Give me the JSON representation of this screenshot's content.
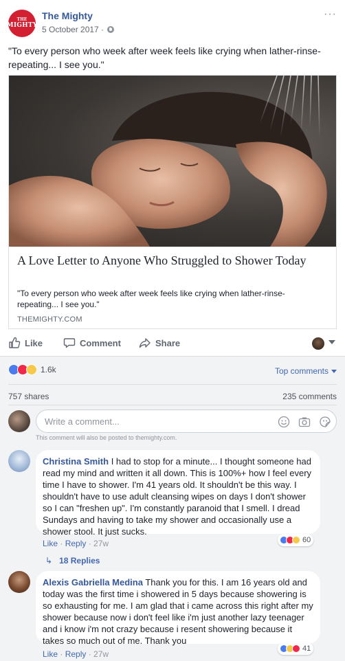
{
  "post": {
    "page_name": "The Mighty",
    "logo_small": "THE",
    "logo_big": "MIGHTY",
    "date": "5 October 2017 ·",
    "more": "···",
    "text": "\"To every person who week after week feels like crying when lather-rinse-repeating... I see you.\""
  },
  "link": {
    "title": "A Love Letter to Anyone Who Struggled to Shower Today",
    "description": "\"To every person who week after week feels like crying when lather-rinse-repeating... I see you.\"",
    "domain": "THEMIGHTY.COM"
  },
  "actions": {
    "like": "Like",
    "comment": "Comment",
    "share": "Share"
  },
  "stats": {
    "reactions_count": "1.6k",
    "sort_label": "Top comments",
    "shares": "757 shares",
    "comments": "235 comments"
  },
  "composer": {
    "placeholder": "Write a comment...",
    "notice": "This comment will also be posted to themighty.com."
  },
  "comments": [
    {
      "author": "Christina Smith",
      "text": "I had to stop for a minute... I thought someone had read my mind and written it all down. This is 100%+ how I feel every time I have to shower. I'm 41 years old. It shouldn't be this way. I shouldn't have to use adult cleansing wipes on days I don't shower so I can \"freshen up\". I'm constantly paranoid that I smell. I dread Sundays and having to take my shower and occasionally use a shower stool. It just sucks.",
      "reactions": "60",
      "like": "Like",
      "reply": "Reply",
      "time": "27w",
      "replies": "18 Replies"
    },
    {
      "author": "Alexis Gabriella Medina",
      "text": "Thank you for this. I am 16 years old and today was the first time i showered in 5 days because showering is so exhausting for me. I am glad that i came across this right after my shower because now i don't feel like i'm just another lazy teenager and i know i'm not crazy because i resent showering because it takes so much out of me. Thank you",
      "reactions": "41",
      "like": "Like",
      "reply": "Reply",
      "time": "27w"
    }
  ],
  "colors": {
    "link_blue": "#365899",
    "brand_red": "#d21f32",
    "like_blue": "#4a7cf0",
    "love_red": "#f0284a"
  }
}
